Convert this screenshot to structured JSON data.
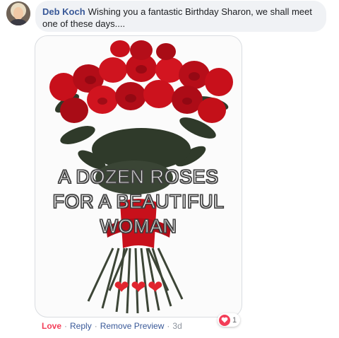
{
  "comment": {
    "author": "Deb Koch",
    "text": "Wishing you a fantastic Birthday Sharon, we shall meet one of these days...."
  },
  "gif": {
    "caption_lines": [
      "A DOZEN ROSES",
      "FOR A BEAUTIFUL",
      "WOMAN"
    ],
    "hearts": [
      "❤",
      "❤",
      "❤"
    ]
  },
  "actions": {
    "love": "Love",
    "reply": "Reply",
    "remove_preview": "Remove Preview",
    "time": "3d",
    "separator": "·"
  },
  "reactions": {
    "icon": "heart-icon",
    "count": "1"
  },
  "colors": {
    "link": "#385898",
    "love": "#f33e58",
    "bubble": "#f0f2f5",
    "rose": "#c8101b"
  }
}
